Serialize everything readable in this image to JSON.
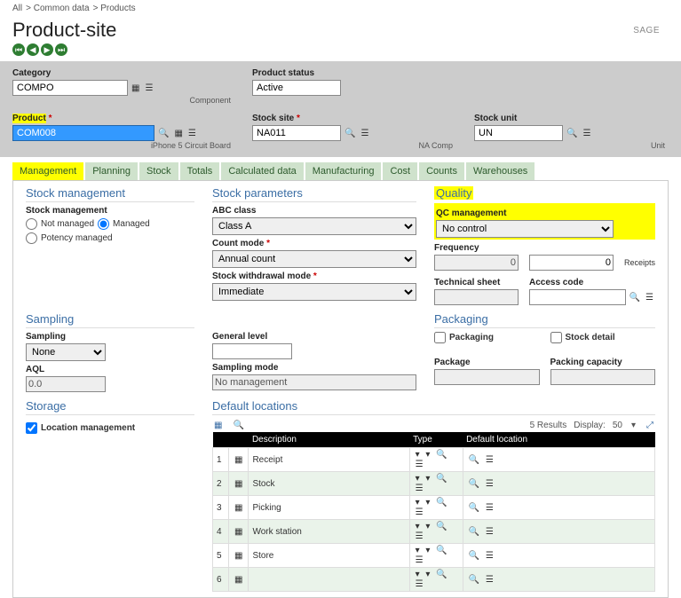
{
  "breadcrumb": [
    "All",
    "Common data",
    "Products"
  ],
  "brand": "SAGE",
  "page_title": "Product-site",
  "form": {
    "category": {
      "label": "Category",
      "value": "COMPO",
      "sub": "Component"
    },
    "product_status": {
      "label": "Product status",
      "value": "Active"
    },
    "product": {
      "label": "Product",
      "value": "COM008",
      "sub": "iPhone 5 Circuit Board"
    },
    "stock_site": {
      "label": "Stock site",
      "value": "NA011",
      "sub": "NA Comp"
    },
    "stock_unit": {
      "label": "Stock unit",
      "value": "UN",
      "sub": "Unit"
    }
  },
  "tabs": [
    "Management",
    "Planning",
    "Stock",
    "Totals",
    "Calculated data",
    "Manufacturing",
    "Cost",
    "Counts",
    "Warehouses"
  ],
  "sections": {
    "stock_mgmt": {
      "title": "Stock management",
      "label": "Stock management",
      "opt_not_managed": "Not managed",
      "opt_managed": "Managed",
      "opt_potency": "Potency managed"
    },
    "stock_params": {
      "title": "Stock parameters",
      "abc_label": "ABC class",
      "abc_value": "Class A",
      "count_mode_label": "Count mode",
      "count_mode_value": "Annual count",
      "withdraw_label": "Stock withdrawal mode",
      "withdraw_value": "Immediate"
    },
    "quality": {
      "title": "Quality",
      "qc_label": "QC management",
      "qc_value": "No control",
      "freq_label": "Frequency",
      "freq1": "0",
      "freq2": "0",
      "receipts": "Receipts",
      "tech_sheet": "Technical sheet",
      "access_code": "Access code"
    },
    "sampling": {
      "title": "Sampling",
      "sampling_label": "Sampling",
      "sampling_value": "None",
      "aql_label": "AQL",
      "aql_value": "0.0",
      "general_level": "General level",
      "mode_label": "Sampling mode",
      "mode_value": "No management"
    },
    "packaging": {
      "title": "Packaging",
      "packaging_cb": "Packaging",
      "stock_detail": "Stock detail",
      "package_label": "Package",
      "pack_cap_label": "Packing capacity"
    },
    "storage": {
      "title": "Storage",
      "loc_mgmt": "Location management"
    },
    "default_loc": {
      "title": "Default locations",
      "results": "5 Results",
      "display": "Display:",
      "page": "50",
      "cols": {
        "desc": "Description",
        "type": "Type",
        "def": "Default location"
      },
      "rows": [
        {
          "n": "1",
          "d": "Receipt"
        },
        {
          "n": "2",
          "d": "Stock"
        },
        {
          "n": "3",
          "d": "Picking"
        },
        {
          "n": "4",
          "d": "Work station"
        },
        {
          "n": "5",
          "d": "Store"
        },
        {
          "n": "6",
          "d": ""
        }
      ]
    }
  }
}
